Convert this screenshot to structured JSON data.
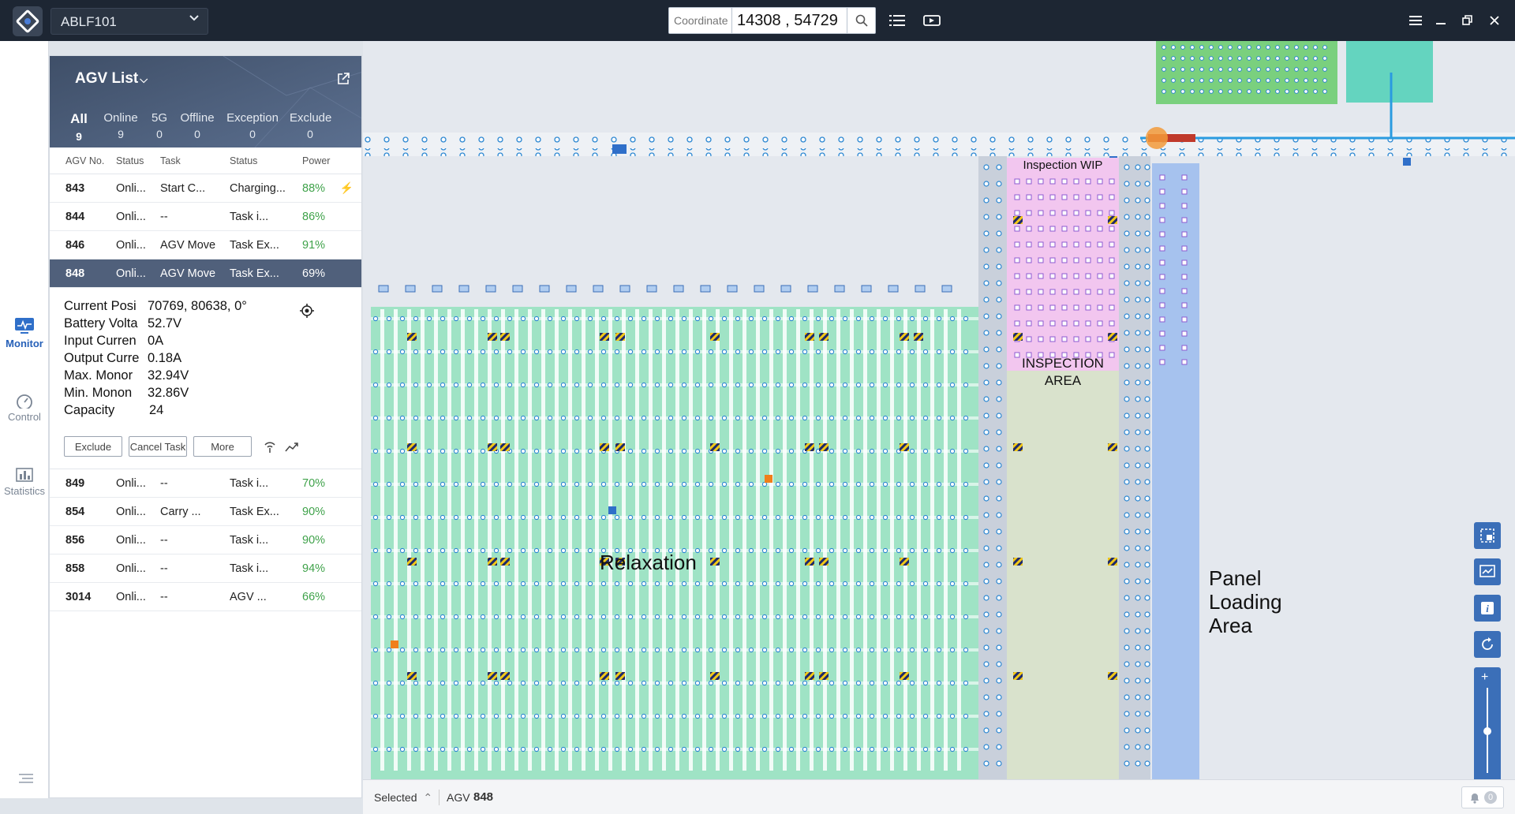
{
  "topbar": {
    "site": "ABLF101",
    "coord_placeholder": "Coordinate",
    "coord_value": "14308 , 54729"
  },
  "rail": {
    "monitor": "Monitor",
    "control": "Control",
    "statistics": "Statistics"
  },
  "panel": {
    "title": "AGV List",
    "tabs": [
      {
        "label": "All",
        "count": "9"
      },
      {
        "label": "Online",
        "count": "9"
      },
      {
        "label": "5G",
        "count": "0"
      },
      {
        "label": "Offline",
        "count": "0"
      },
      {
        "label": "Exception",
        "count": "0"
      },
      {
        "label": "Exclude",
        "count": "0"
      }
    ],
    "columns": [
      "AGV No.",
      "Status",
      "Task",
      "Status",
      "Power"
    ],
    "rows_top": [
      {
        "no": "843",
        "status": "Onli...",
        "task": "Start C...",
        "tstatus": "Charging...",
        "power": "88%",
        "charging": true
      },
      {
        "no": "844",
        "status": "Onli...",
        "task": "--",
        "tstatus": "Task i...",
        "power": "86%"
      },
      {
        "no": "846",
        "status": "Onli...",
        "task": "AGV Move",
        "tstatus": "Task Ex...",
        "power": "91%"
      },
      {
        "no": "848",
        "status": "Onli...",
        "task": "AGV Move",
        "tstatus": "Task Ex...",
        "power": "69%"
      }
    ],
    "detail": [
      {
        "label": "Current Posi",
        "value": "70769,  80638, 0°"
      },
      {
        "label": "Battery Volta",
        "value": "52.7V"
      },
      {
        "label": "Input Curren",
        "value": "0A"
      },
      {
        "label": "Output Curre",
        "value": "0.18A"
      },
      {
        "label": "Max. Monor",
        "value": "32.94V"
      },
      {
        "label": "Min. Monon",
        "value": "32.86V"
      },
      {
        "label": "Capacity",
        "value": "24"
      }
    ],
    "buttons": {
      "exclude": "Exclude",
      "cancel": "Cancel Task",
      "more": "More"
    },
    "rows_bottom": [
      {
        "no": "849",
        "status": "Onli...",
        "task": "--",
        "tstatus": "Task i...",
        "power": "70%"
      },
      {
        "no": "854",
        "status": "Onli...",
        "task": "Carry ...",
        "tstatus": "Task Ex...",
        "power": "90%"
      },
      {
        "no": "856",
        "status": "Onli...",
        "task": "--",
        "tstatus": "Task i...",
        "power": "90%"
      },
      {
        "no": "858",
        "status": "Onli...",
        "task": "--",
        "tstatus": "Task i...",
        "power": "94%"
      },
      {
        "no": "3014",
        "status": "Onli...",
        "task": "--",
        "tstatus": "AGV ...",
        "power": "66%"
      }
    ]
  },
  "map": {
    "relaxation": "Relaxation",
    "inspection_wip": "Inspection WIP",
    "inspection_area_1": "INSPECTION",
    "inspection_area_2": "AREA",
    "panel_loading_1": "Panel",
    "panel_loading_2": "Loading",
    "panel_loading_3": "Area"
  },
  "statusbar": {
    "selected": "Selected",
    "agv_label": "AGV",
    "agv_no": "848",
    "alarm_count": "0"
  },
  "colors": {
    "topbar": "#1d2633",
    "green_area": "#9fe3c5",
    "pink_area": "#f2c6ef",
    "beige_area": "#d9e2cc",
    "blue_area": "#a6c2ee",
    "accent": "#2f6fc9"
  }
}
